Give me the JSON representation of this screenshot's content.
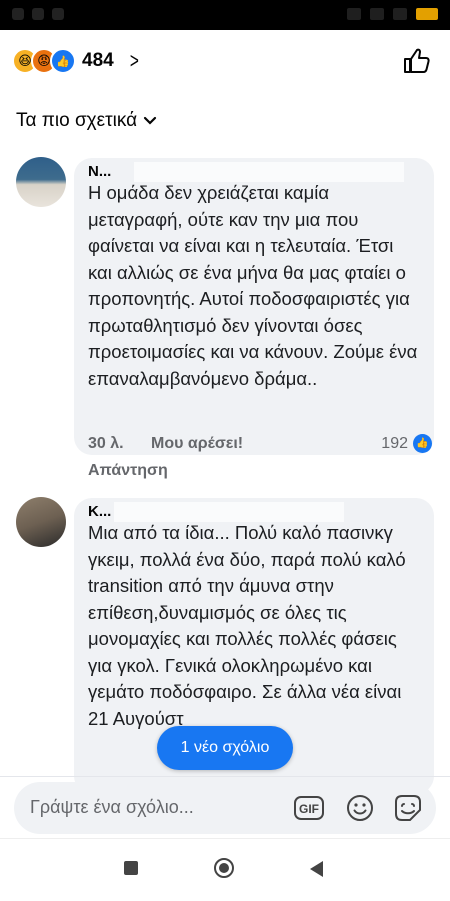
{
  "reactions": {
    "count": "484",
    "icons": [
      "haha-emoji",
      "angry-emoji",
      "like-emoji"
    ]
  },
  "sort": {
    "label": "Τα πιο σχετικά"
  },
  "comments": [
    {
      "author": "Ν...",
      "text": "Η ομάδα δεν χρειάζεται καμία μεταγραφή, ούτε καν την μια που φαίνεται να είναι και η τελευταία. Έτσι και αλλιώς σε ένα μήνα θα μας φταίει ο προπονητής. Αυτοί ποδοσφαιριστές για πρωταθλητισμό δεν γίνονται όσες προετοιμασίες και να κάνουν. Ζούμε ένα επαναλαμβανόμενο δράμα..",
      "time": "30 λ.",
      "like_label": "Μου αρέσει!",
      "reply_label": "Απάντηση",
      "like_count": "192"
    },
    {
      "author": "Κ...",
      "text": "Μια από τα ίδια... Πολύ καλό πασινκγ γκειμ, πολλά ένα δύο, παρά πολύ καλό transition από την άμυνα στην επίθεση,δυναμισμός σε όλες τις μονομαχίες και πολλές πολλές φάσεις για γκολ. Γενικά ολοκληρωμένο και γεμάτο ποδόσφαιρο. Σε άλλα νέα είναι 21 Αυγούστ"
    }
  ],
  "new_comments_pill": "1 νέο σχόλιο",
  "composer": {
    "placeholder": "Γράψτε ένα σχόλιο...",
    "gif_label": "GIF"
  },
  "colors": {
    "accent": "#1877f2",
    "bubble": "#f0f2f5",
    "secondary_text": "#65676b"
  }
}
